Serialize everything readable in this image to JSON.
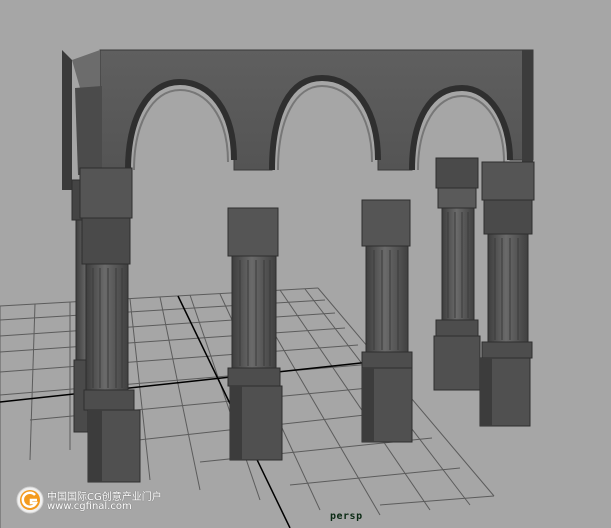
{
  "viewport": {
    "camera_label": "persp",
    "background_color": "#a6a6a6",
    "grid_color": "#5c5c5c",
    "axis_color": "#000000",
    "model_color": "#595959"
  },
  "scene": {
    "model_name": "arcade-arches",
    "column_count": 5,
    "arch_count": 3
  },
  "watermark": {
    "logo_icon": "cgfinal-logo-icon",
    "line1": "中国国际CG创意产业门户",
    "line2": "www.cgfinal.com"
  }
}
